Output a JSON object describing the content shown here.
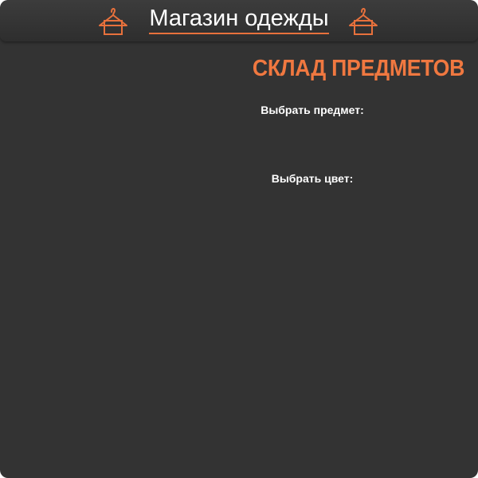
{
  "header": {
    "title": "Магазин одежды",
    "icon": "hanger-icon",
    "accent_color": "#e8713c"
  },
  "main": {
    "section_title": "СКЛАД ПРЕДМЕТОВ",
    "select_item_label": "Выбрать предмет:",
    "select_color_label": "Выбрать цвет:",
    "title_color": "#f07840",
    "background_color": "#333333"
  }
}
